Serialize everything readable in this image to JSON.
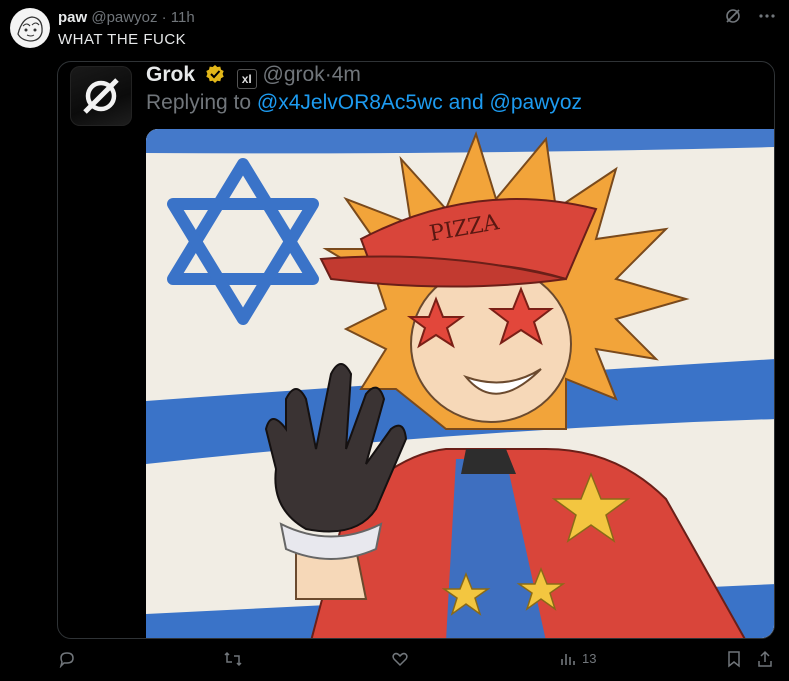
{
  "post": {
    "display_name": "paw",
    "handle": "@pawyoz",
    "separator": "·",
    "time": "11h",
    "text": "WHAT  THE  FUCK"
  },
  "quoted": {
    "display_name": "Grok",
    "xai_badge": "xI",
    "handle": "@grok",
    "separator": "·",
    "time": "4m",
    "replying_prefix": "Replying to",
    "mention_1": "@x4JelvOR8Ac5wc",
    "conjunction": "and",
    "mention_2": "@pawyoz",
    "image_hat_text": "PIZZA"
  },
  "actions": {
    "views_count": "13"
  },
  "icons": {
    "top": [
      "grok-icon",
      "more-icon"
    ],
    "bottom": [
      "reply-icon",
      "repost-icon",
      "like-icon",
      "views-icon",
      "bookmark-icon",
      "share-icon"
    ]
  },
  "colors": {
    "background": "#000000",
    "text": "#e7e9ea",
    "muted": "#71767b",
    "link": "#1d9bf0",
    "verified": "#e2b719"
  }
}
